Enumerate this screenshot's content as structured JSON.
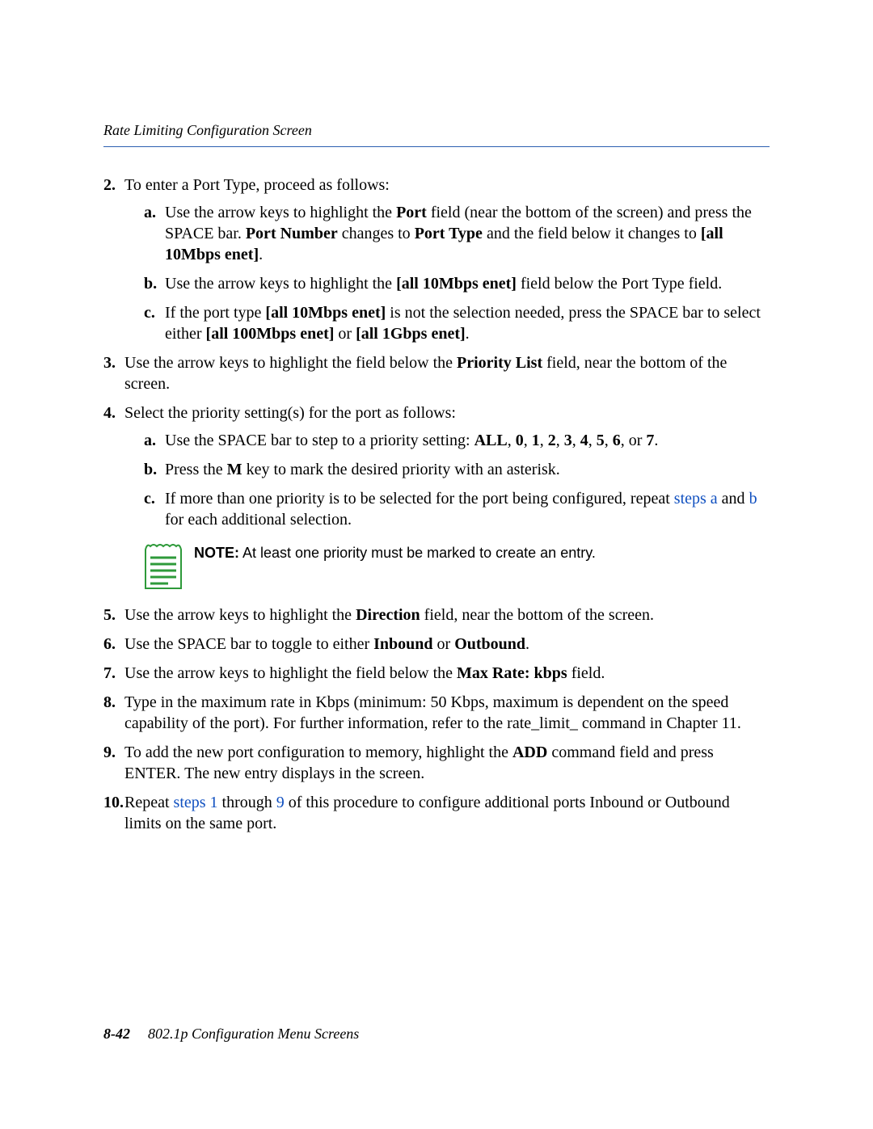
{
  "header": {
    "running_head": "Rate Limiting Configuration Screen"
  },
  "steps": {
    "s2": {
      "num": "2.",
      "text": "To enter a Port Type, proceed as follows:",
      "a": {
        "m": "a.",
        "t1": "Use the arrow keys to highlight the ",
        "port": "Port",
        "t2": " field (near the bottom of the screen) and press the SPACE bar. ",
        "pn": "Port Number",
        "t3": " changes to ",
        "pt": "Port Type",
        "t4": " and the field below it changes to ",
        "all10": "[all 10Mbps enet]",
        "t5": "."
      },
      "b": {
        "m": "b.",
        "t1": "Use the arrow keys to highlight the ",
        "all10": "[all 10Mbps enet]",
        "t2": " field below the Port Type field."
      },
      "c": {
        "m": "c.",
        "t1": "If the port type ",
        "all10": "[all 10Mbps enet]",
        "t2": " is not the selection needed, press the SPACE bar to select either ",
        "all100": "[all 100Mbps enet]",
        "or": " or ",
        "all1g": "[all 1Gbps enet]",
        "t3": "."
      }
    },
    "s3": {
      "num": "3.",
      "t1": "Use the arrow keys to highlight the field below the ",
      "pl": "Priority List",
      "t2": " field, near the bottom of the screen."
    },
    "s4": {
      "num": "4.",
      "text": "Select the priority setting(s) for the port as follows:",
      "a": {
        "m": "a.",
        "t1": "Use the SPACE bar to step to a priority setting: ",
        "all": "ALL",
        "c1": ", ",
        "v0": "0",
        "c2": ", ",
        "v1": "1",
        "c3": ", ",
        "v2": "2",
        "c4": ", ",
        "v3": "3",
        "c5": ", ",
        "v4": "4",
        "c6": ", ",
        "v5": "5",
        "c7": ", ",
        "v6": "6",
        "c8": ", or ",
        "v7": "7",
        "c9": "."
      },
      "b": {
        "m": "b.",
        "t1": "Press the ",
        "mkey": "M",
        "t2": " key to mark the desired priority with an asterisk."
      },
      "c": {
        "m": "c.",
        "t1": "If more than one priority is to be selected for the port being configured, repeat ",
        "la": "steps a",
        "and": " and ",
        "lb": "b",
        "t2": " for each additional selection."
      }
    },
    "note": {
      "label": "NOTE:",
      "text": "  At least one priority must be marked to create an entry."
    },
    "s5": {
      "num": "5.",
      "t1": "Use the arrow keys to highlight the ",
      "dir": "Direction",
      "t2": " field, near the bottom of the screen."
    },
    "s6": {
      "num": "6.",
      "t1": "Use the SPACE bar to toggle to either ",
      "in": "Inbound",
      "or": " or ",
      "out": "Outbound",
      "t2": "."
    },
    "s7": {
      "num": "7.",
      "t1": "Use the arrow keys to highlight the field below the ",
      "mr": "Max Rate: kbps",
      "t2": " field."
    },
    "s8": {
      "num": "8.",
      "t1": "Type in the maximum rate in Kbps (minimum: 50 Kbps, maximum is dependent on the speed capability of the port). For further information, refer to the rate_limit_ command in Chapter 11."
    },
    "s9": {
      "num": "9.",
      "t1": "To add the new port configuration to memory, highlight the ",
      "add": "ADD",
      "t2": " command field and press ENTER. The new entry displays in the screen."
    },
    "s10": {
      "num": "10.",
      "t1": "Repeat ",
      "l1": "steps 1",
      "thr": " through ",
      "l9": "9",
      "t2": " of this procedure to configure additional ports Inbound or Outbound limits on the same port."
    }
  },
  "footer": {
    "page_num": "8-42",
    "title": "802.1p Configuration Menu Screens"
  }
}
